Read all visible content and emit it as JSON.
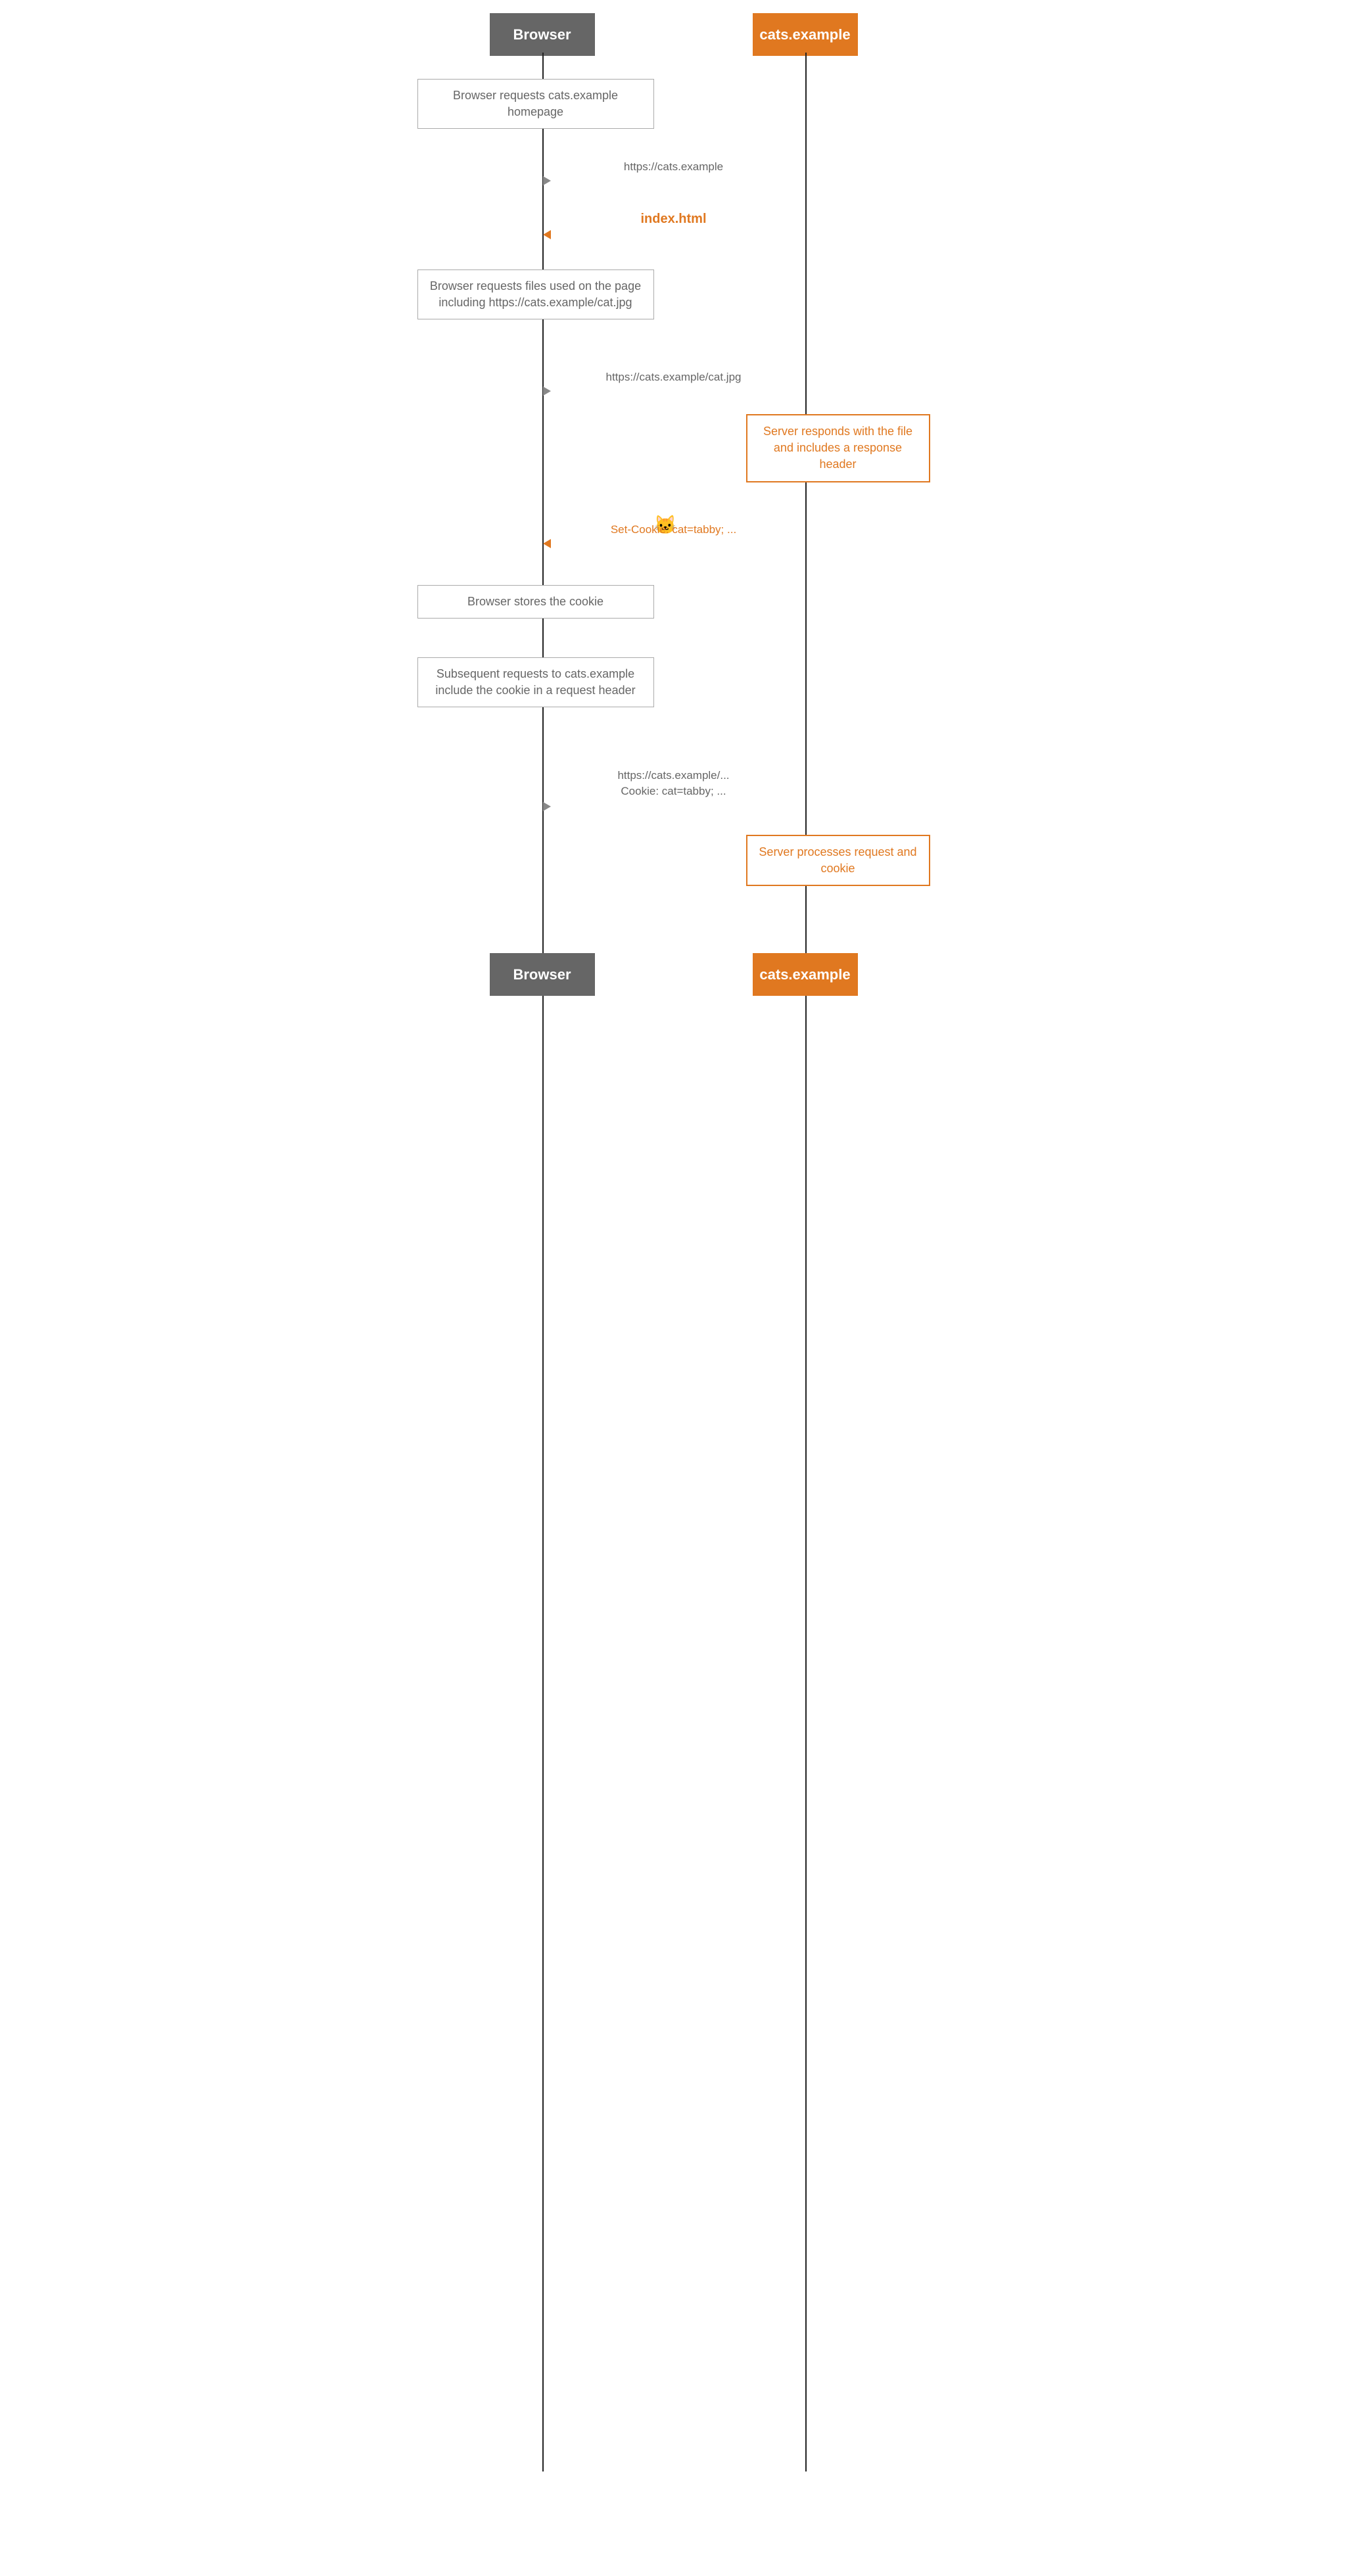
{
  "actors": {
    "browser_label": "Browser",
    "server_label": "cats.example"
  },
  "notes": {
    "note1": "Browser requests cats.example homepage",
    "note2": "Browser requests files used on the page including https://cats.example/cat.jpg",
    "note3": "Browser stores the cookie",
    "note4": "Subsequent requests to cats.example include the cookie in a request header",
    "note5_orange": "Server responds with the file and includes a response header",
    "note6_orange": "Server processes request and cookie"
  },
  "arrows": {
    "arrow1_label": "https://cats.example",
    "arrow2_label": "index.html",
    "arrow3_label": "https://cats.example/cat.jpg",
    "arrow4_emoji": "🐱",
    "arrow4_label": "Set-Cookie: cat=tabby; ...",
    "arrow5_line1": "https://cats.example/...",
    "arrow5_line2": "Cookie: cat=tabby; ..."
  }
}
